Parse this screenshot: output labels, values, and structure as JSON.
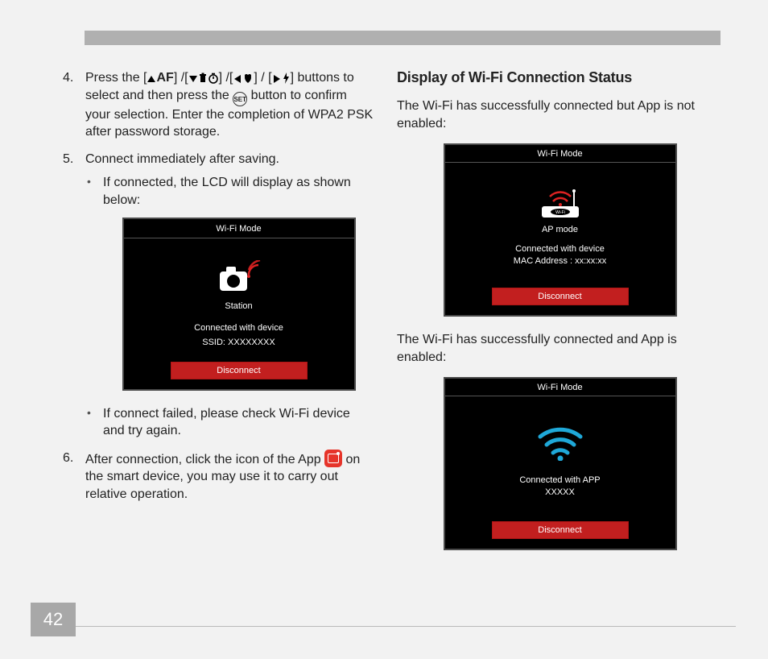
{
  "page_number": "42",
  "left": {
    "step4_a": "Press the [",
    "step4_b": "] /[",
    "step4_c": "] /[",
    "step4_d": "] / [",
    "step4_e": "] buttons to select and then press the ",
    "step4_f": " button to confirm your selection. Enter the completion of WPA2 PSK after password storage.",
    "af_label": "AF",
    "set_label": "SET",
    "step5": "Connect immediately after saving.",
    "step5_bullet1": "If connected, the LCD will display as shown below:",
    "step5_bullet2": "If connect failed, please check Wi-Fi device and try again.",
    "step6_a": "After connection, click the icon of the App ",
    "step6_b": " on the smart device, you may use it to carry out relative operation."
  },
  "right": {
    "heading": "Display of Wi-Fi Connection Status",
    "para1": "The Wi-Fi has successfully connected but App is not enabled:",
    "para2": "The Wi-Fi has successfully connected and App is enabled:"
  },
  "lcd": {
    "title": "Wi-Fi Mode",
    "disconnect": "Disconnect",
    "station": {
      "mode": "Station",
      "status": "Connected with device",
      "sub": "SSID: XXXXXXXX"
    },
    "ap": {
      "mode": "AP mode",
      "status": "Connected with device",
      "sub": "MAC Address : xx:xx:xx"
    },
    "app": {
      "status": "Connected with APP",
      "sub": "XXXXX"
    }
  }
}
